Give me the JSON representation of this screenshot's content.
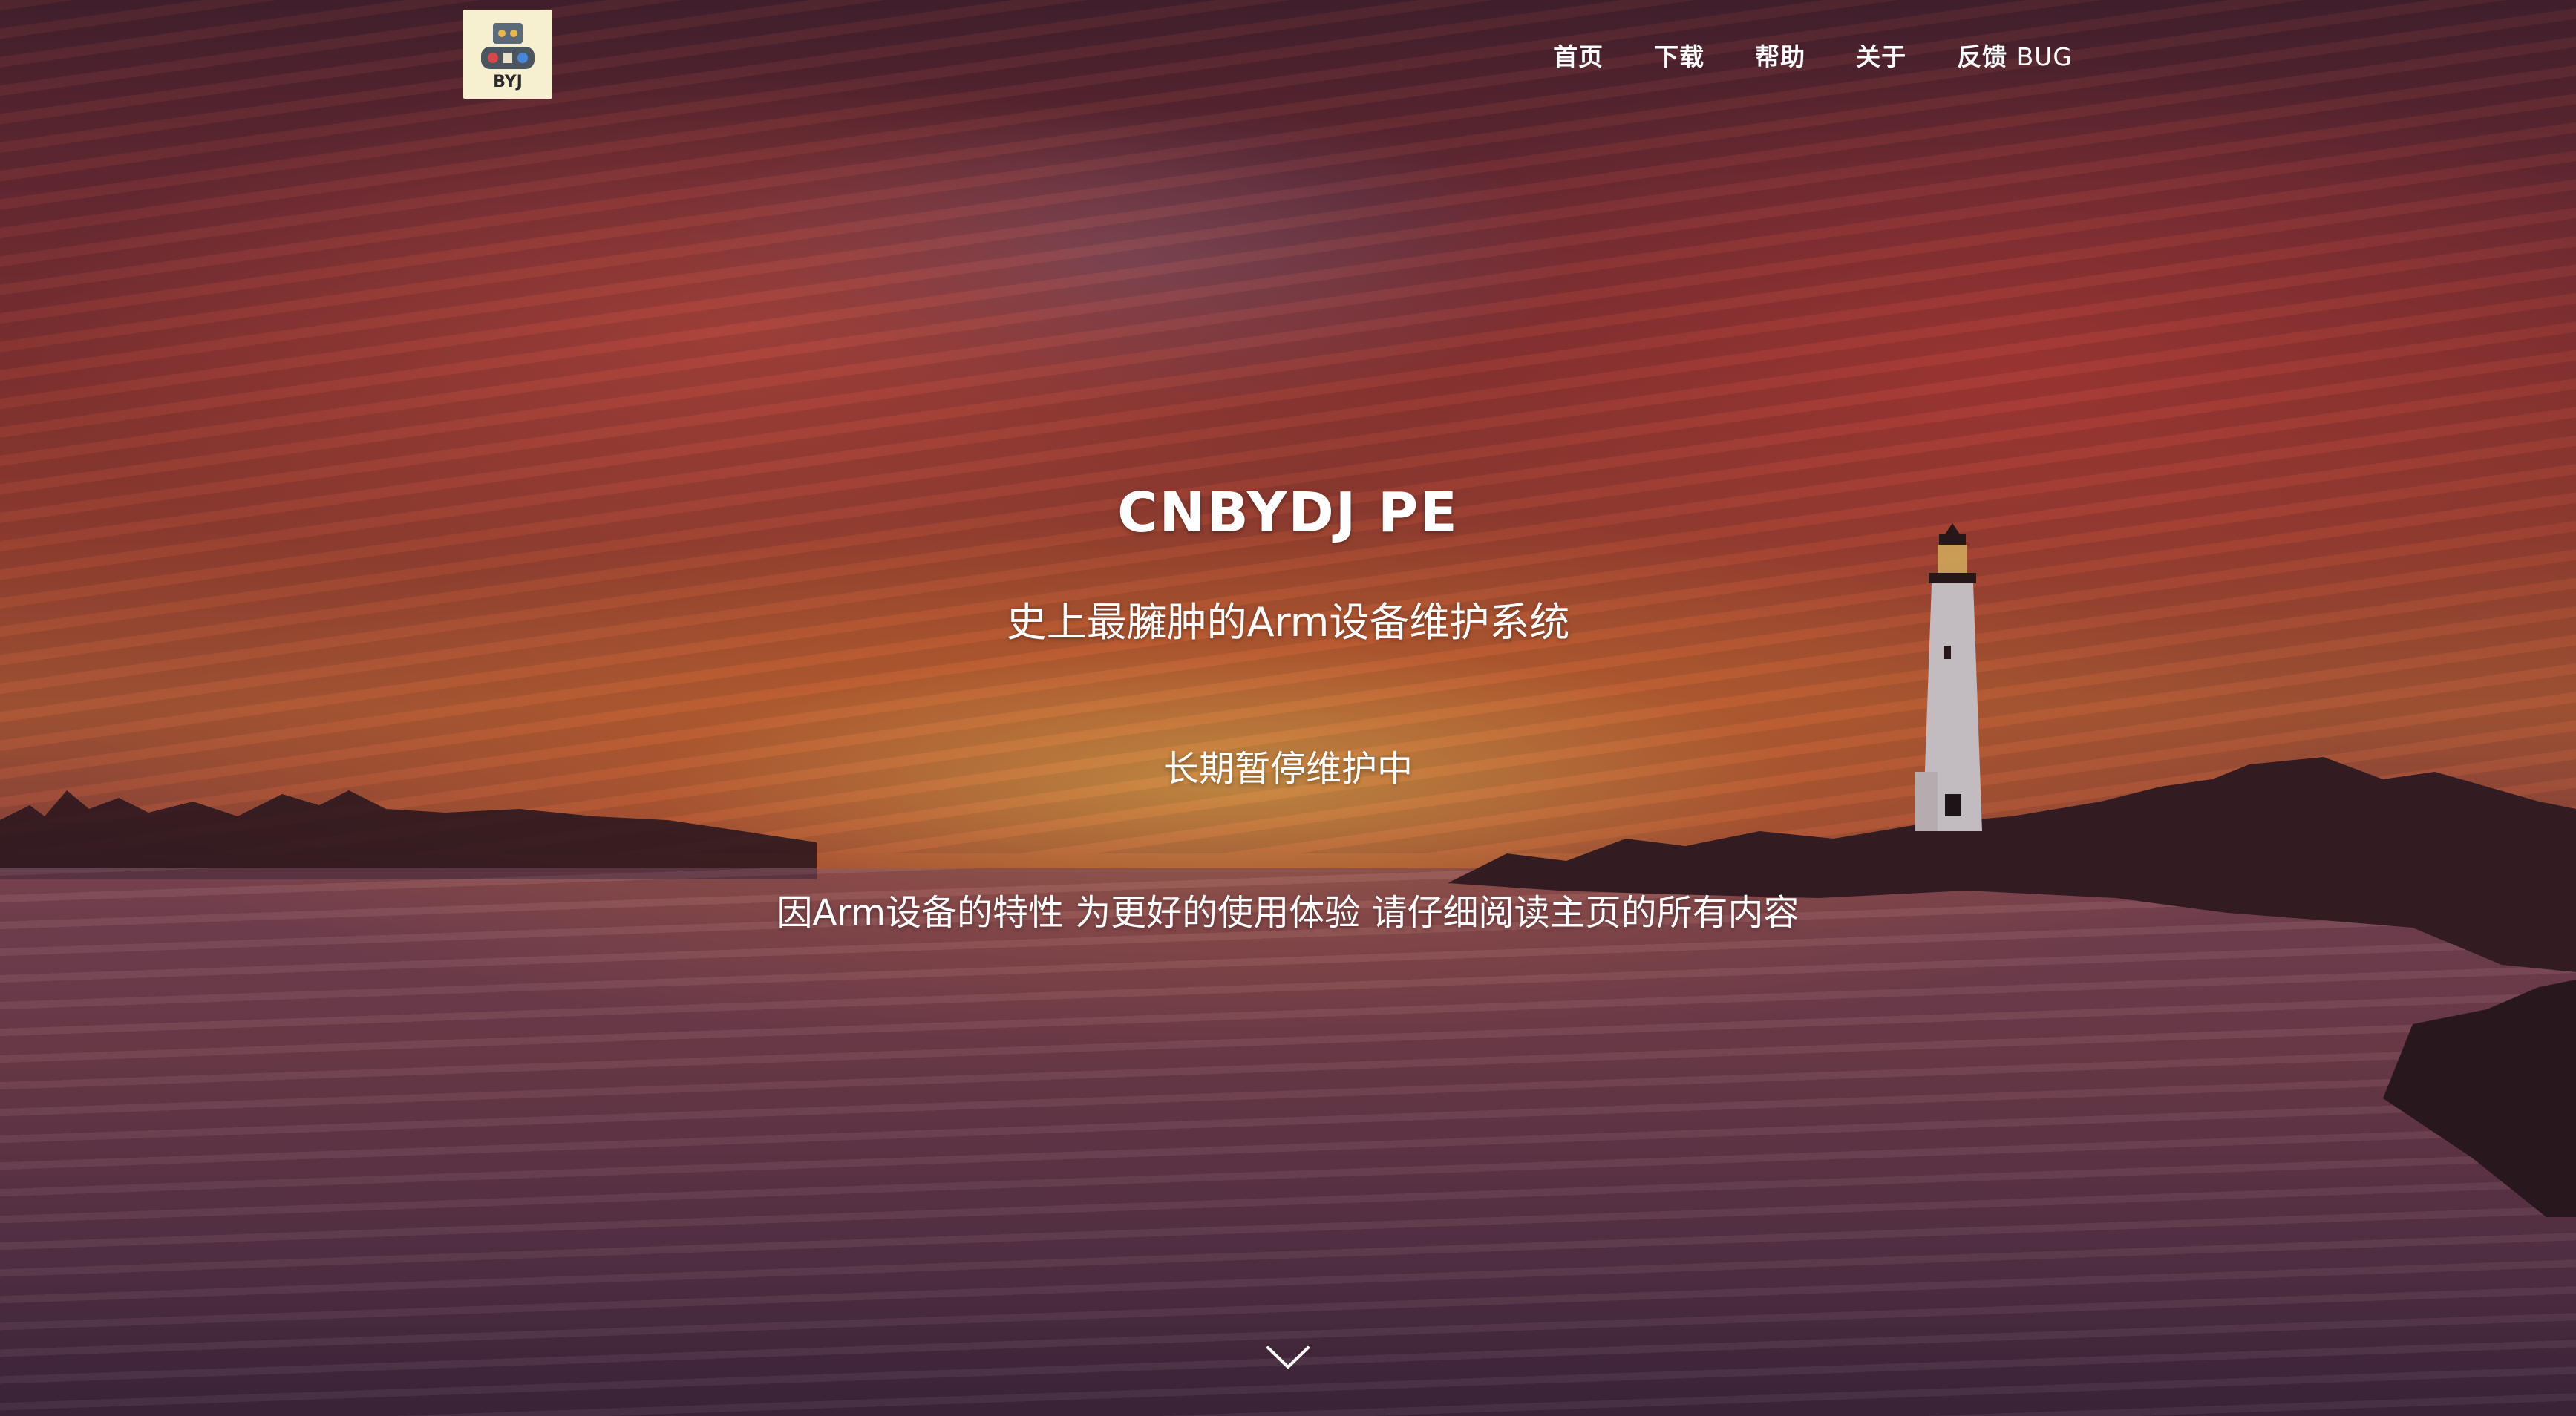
{
  "brand": {
    "logo_text": "BYJ",
    "logo_icon": "robot-logo-icon"
  },
  "nav": {
    "items": [
      {
        "label": "首页"
      },
      {
        "label": "下载"
      },
      {
        "label": "帮助"
      },
      {
        "label": "关于"
      },
      {
        "label": "反馈",
        "suffix": "BUG"
      }
    ]
  },
  "hero": {
    "title": "CNBYDJ PE",
    "subtitle": "史上最臃肿的Arm设备维护系统",
    "status": "长期暂停维护中",
    "notice": "因Arm设备的特性 为更好的使用体验 请仔细阅读主页的所有内容"
  },
  "scroll": {
    "icon": "chevron-down-icon"
  },
  "colors": {
    "text": "#ffffff",
    "logo_bg": "#f6efd0",
    "sky_accent": "#c8683a"
  }
}
